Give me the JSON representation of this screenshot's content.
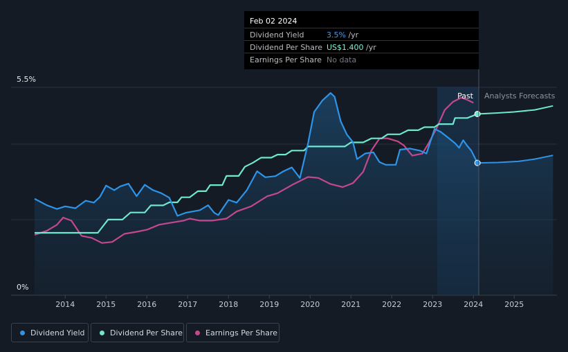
{
  "tooltip": {
    "date": "Feb 02 2024",
    "rows": [
      {
        "label": "Dividend Yield",
        "value": "3.5%",
        "unit": " /yr",
        "color": "#3f9cf0"
      },
      {
        "label": "Dividend Per Share",
        "value": "US$1.400",
        "unit": " /yr",
        "color": "#7ef2d5"
      },
      {
        "label": "Earnings Per Share",
        "value": "No data",
        "unit": "",
        "color": "#777c84"
      }
    ]
  },
  "regions": {
    "past": "Past",
    "forecast": "Analysts Forecasts"
  },
  "legend": [
    {
      "label": "Dividend Yield",
      "color": "#2e94e8"
    },
    {
      "label": "Dividend Per Share",
      "color": "#6ee8cf"
    },
    {
      "label": "Earnings Per Share",
      "color": "#c5488f"
    }
  ],
  "chart_data": {
    "type": "line",
    "title": "",
    "xlabel": "",
    "ylabel": "",
    "x_ticks": [
      "2014",
      "2015",
      "2016",
      "2017",
      "2018",
      "2019",
      "2020",
      "2021",
      "2022",
      "2023",
      "2024",
      "2025"
    ],
    "y_ticks": [
      "5.5%",
      "0%"
    ],
    "xlim": [
      2013.25,
      2025.95
    ],
    "ylim_yield_percent": [
      0,
      5.5
    ],
    "grid": "horizontal",
    "legend_placement": "bottom",
    "series": [
      {
        "name": "Dividend Yield",
        "units": "percent",
        "color": "#2e94e8",
        "points": [
          [
            2013.25,
            2.55
          ],
          [
            2013.55,
            2.38
          ],
          [
            2013.8,
            2.28
          ],
          [
            2014.0,
            2.35
          ],
          [
            2014.25,
            2.3
          ],
          [
            2014.5,
            2.5
          ],
          [
            2014.7,
            2.45
          ],
          [
            2014.85,
            2.6
          ],
          [
            2015.0,
            2.9
          ],
          [
            2015.2,
            2.78
          ],
          [
            2015.35,
            2.88
          ],
          [
            2015.55,
            2.95
          ],
          [
            2015.75,
            2.62
          ],
          [
            2015.95,
            2.92
          ],
          [
            2016.15,
            2.78
          ],
          [
            2016.35,
            2.7
          ],
          [
            2016.55,
            2.58
          ],
          [
            2016.75,
            2.1
          ],
          [
            2016.95,
            2.18
          ],
          [
            2017.15,
            2.22
          ],
          [
            2017.3,
            2.25
          ],
          [
            2017.5,
            2.38
          ],
          [
            2017.65,
            2.18
          ],
          [
            2017.75,
            2.12
          ],
          [
            2018.0,
            2.52
          ],
          [
            2018.2,
            2.45
          ],
          [
            2018.45,
            2.78
          ],
          [
            2018.7,
            3.28
          ],
          [
            2018.9,
            3.12
          ],
          [
            2019.15,
            3.15
          ],
          [
            2019.35,
            3.28
          ],
          [
            2019.55,
            3.38
          ],
          [
            2019.75,
            3.1
          ],
          [
            2019.95,
            4.02
          ],
          [
            2020.1,
            4.85
          ],
          [
            2020.3,
            5.15
          ],
          [
            2020.5,
            5.35
          ],
          [
            2020.6,
            5.25
          ],
          [
            2020.75,
            4.6
          ],
          [
            2020.9,
            4.25
          ],
          [
            2021.05,
            4.05
          ],
          [
            2021.15,
            3.6
          ],
          [
            2021.35,
            3.75
          ],
          [
            2021.55,
            3.78
          ],
          [
            2021.7,
            3.52
          ],
          [
            2021.85,
            3.45
          ],
          [
            2022.1,
            3.45
          ],
          [
            2022.2,
            3.85
          ],
          [
            2022.45,
            3.88
          ],
          [
            2022.7,
            3.82
          ],
          [
            2022.85,
            3.75
          ],
          [
            2023.05,
            4.4
          ],
          [
            2023.2,
            4.32
          ],
          [
            2023.4,
            4.15
          ],
          [
            2023.55,
            4.02
          ],
          [
            2023.65,
            3.9
          ],
          [
            2023.75,
            4.1
          ],
          [
            2023.85,
            3.95
          ],
          [
            2023.95,
            3.82
          ],
          [
            2024.1,
            3.5
          ]
        ],
        "forecast": [
          [
            2024.1,
            3.5
          ],
          [
            2024.6,
            3.51
          ],
          [
            2025.1,
            3.54
          ],
          [
            2025.5,
            3.6
          ],
          [
            2025.95,
            3.7
          ]
        ]
      },
      {
        "name": "Dividend Per Share",
        "units": "US$",
        "color": "#6ee8cf",
        "points": [
          [
            2013.25,
            0.6
          ],
          [
            2013.6,
            0.6
          ],
          [
            2014.4,
            0.6
          ],
          [
            2014.8,
            0.6
          ],
          [
            2015.05,
            0.73
          ],
          [
            2015.4,
            0.73
          ],
          [
            2015.6,
            0.8
          ],
          [
            2015.95,
            0.8
          ],
          [
            2016.1,
            0.87
          ],
          [
            2016.4,
            0.87
          ],
          [
            2016.55,
            0.9
          ],
          [
            2016.75,
            0.9
          ],
          [
            2016.85,
            0.95
          ],
          [
            2017.05,
            0.95
          ],
          [
            2017.25,
            1.01
          ],
          [
            2017.45,
            1.01
          ],
          [
            2017.55,
            1.07
          ],
          [
            2017.85,
            1.07
          ],
          [
            2017.95,
            1.16
          ],
          [
            2018.25,
            1.16
          ],
          [
            2018.4,
            1.25
          ],
          [
            2018.6,
            1.29
          ],
          [
            2018.8,
            1.34
          ],
          [
            2019.05,
            1.34
          ],
          [
            2019.2,
            1.37
          ],
          [
            2019.4,
            1.37
          ],
          [
            2019.55,
            1.41
          ],
          [
            2019.85,
            1.41
          ],
          [
            2019.95,
            1.45
          ],
          [
            2020.3,
            1.45
          ],
          [
            2020.85,
            1.45
          ],
          [
            2021.0,
            1.49
          ],
          [
            2021.3,
            1.49
          ],
          [
            2021.5,
            1.53
          ],
          [
            2021.75,
            1.53
          ],
          [
            2021.9,
            1.57
          ],
          [
            2022.2,
            1.57
          ],
          [
            2022.4,
            1.61
          ],
          [
            2022.65,
            1.61
          ],
          [
            2022.8,
            1.64
          ],
          [
            2023.05,
            1.64
          ],
          [
            2023.15,
            1.67
          ],
          [
            2023.5,
            1.67
          ],
          [
            2023.55,
            1.73
          ],
          [
            2023.85,
            1.73
          ],
          [
            2024.1,
            1.77
          ]
        ],
        "forecast": [
          [
            2024.1,
            1.77
          ],
          [
            2024.6,
            1.78
          ],
          [
            2025.0,
            1.79
          ],
          [
            2025.5,
            1.81
          ],
          [
            2025.95,
            1.85
          ]
        ]
      },
      {
        "name": "Earnings Per Share",
        "units": "US$",
        "color": "#c5488f",
        "points": [
          [
            2013.25,
            0.58
          ],
          [
            2013.55,
            0.62
          ],
          [
            2013.8,
            0.68
          ],
          [
            2013.95,
            0.75
          ],
          [
            2014.15,
            0.72
          ],
          [
            2014.4,
            0.57
          ],
          [
            2014.65,
            0.55
          ],
          [
            2014.9,
            0.5
          ],
          [
            2015.15,
            0.51
          ],
          [
            2015.45,
            0.59
          ],
          [
            2015.75,
            0.61
          ],
          [
            2016.0,
            0.63
          ],
          [
            2016.3,
            0.68
          ],
          [
            2016.6,
            0.7
          ],
          [
            2016.9,
            0.72
          ],
          [
            2017.05,
            0.74
          ],
          [
            2017.3,
            0.72
          ],
          [
            2017.6,
            0.72
          ],
          [
            2017.95,
            0.74
          ],
          [
            2018.2,
            0.81
          ],
          [
            2018.55,
            0.86
          ],
          [
            2018.95,
            0.96
          ],
          [
            2019.2,
            0.99
          ],
          [
            2019.6,
            1.08
          ],
          [
            2019.95,
            1.15
          ],
          [
            2020.2,
            1.14
          ],
          [
            2020.5,
            1.08
          ],
          [
            2020.8,
            1.05
          ],
          [
            2021.05,
            1.09
          ],
          [
            2021.3,
            1.2
          ],
          [
            2021.5,
            1.41
          ],
          [
            2021.7,
            1.53
          ],
          [
            2021.9,
            1.53
          ],
          [
            2022.15,
            1.5
          ],
          [
            2022.3,
            1.46
          ],
          [
            2022.5,
            1.36
          ],
          [
            2022.75,
            1.38
          ],
          [
            2022.9,
            1.48
          ],
          [
            2023.1,
            1.63
          ],
          [
            2023.3,
            1.81
          ],
          [
            2023.5,
            1.89
          ],
          [
            2023.7,
            1.93
          ],
          [
            2023.85,
            1.91
          ],
          [
            2024.0,
            1.88
          ]
        ]
      }
    ]
  }
}
